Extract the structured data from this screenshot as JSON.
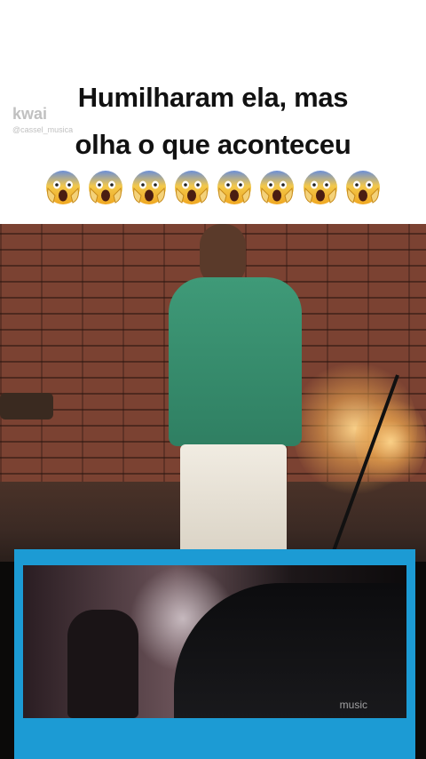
{
  "caption": {
    "line1": "Humilharam ela, mas",
    "line2": "olha o que aconteceu",
    "emoji": "😱",
    "emoji_count": 8
  },
  "watermark": {
    "logo": "kwai",
    "user": "@cassel_musica"
  },
  "video": {
    "inset_watermark": "music"
  },
  "colors": {
    "inset_border": "#1c9bd4",
    "jacket": "#3f9a78"
  }
}
